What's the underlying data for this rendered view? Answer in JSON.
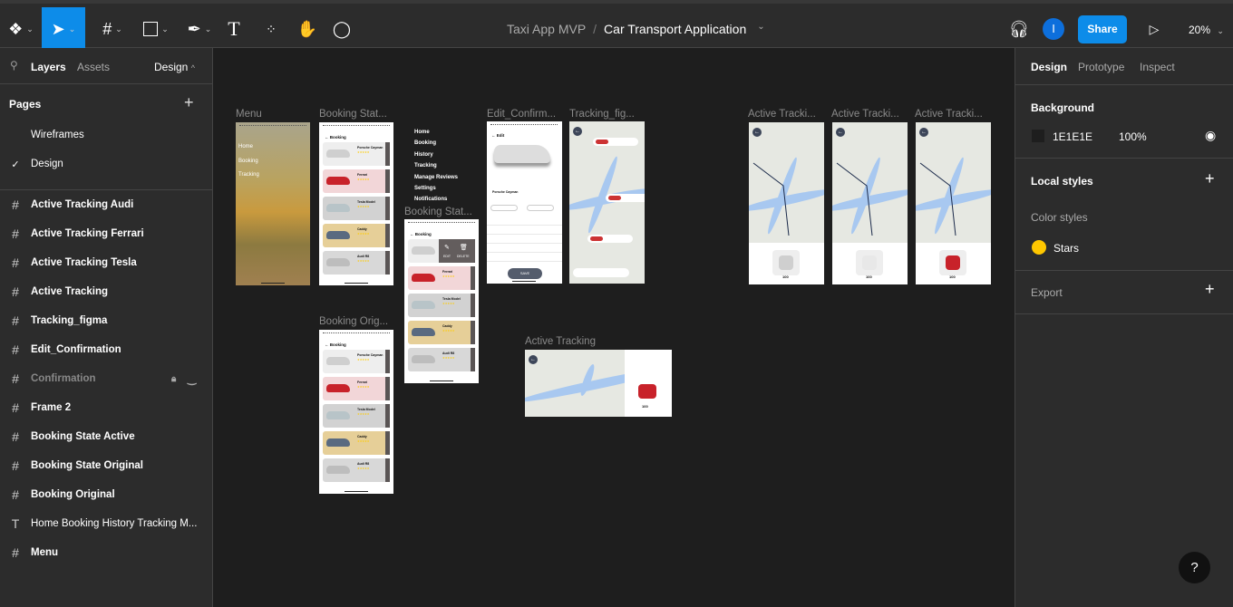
{
  "toolbar": {
    "breadcrumb_project": "Taxi App MVP",
    "breadcrumb_sep": "/",
    "file_name": "Car Transport Application",
    "avatar_initial": "I",
    "share_label": "Share",
    "zoom": "20%",
    "accent": "#0d8ce9"
  },
  "left_panel": {
    "tabs": [
      "Layers",
      "Assets"
    ],
    "page_dropdown": "Design",
    "pages_title": "Pages",
    "pages": [
      {
        "label": "Wireframes",
        "selected": false
      },
      {
        "label": "Design",
        "selected": true
      }
    ],
    "layers": [
      {
        "label": "Active Tracking Audi",
        "type": "frame"
      },
      {
        "label": "Active Tracking Ferrari",
        "type": "frame"
      },
      {
        "label": "Active Tracking Tesla",
        "type": "frame"
      },
      {
        "label": "Active Tracking",
        "type": "frame"
      },
      {
        "label": "Tracking_figma",
        "type": "frame"
      },
      {
        "label": "Edit_Confirmation",
        "type": "frame"
      },
      {
        "label": "Confirmation",
        "type": "frame",
        "hidden": true,
        "locked": true
      },
      {
        "label": "Frame 2",
        "type": "frame"
      },
      {
        "label": "Booking State Active",
        "type": "frame"
      },
      {
        "label": "Booking State Original",
        "type": "frame"
      },
      {
        "label": "Booking Original",
        "type": "frame"
      },
      {
        "label": "Home Booking History Tracking M...",
        "type": "text"
      },
      {
        "label": "Menu",
        "type": "frame"
      }
    ]
  },
  "right_panel": {
    "tabs": [
      "Design",
      "Prototype",
      "Inspect"
    ],
    "background_title": "Background",
    "bg_hex": "1E1E1E",
    "bg_opacity": "100%",
    "local_styles": "Local styles",
    "color_styles": "Color styles",
    "style_name": "Stars",
    "style_color": "#FFC700",
    "export": "Export"
  },
  "canvas": {
    "frame_labels": {
      "menu": "Menu",
      "booking_state1": "Booking Stat...",
      "booking_state2": "Booking Stat...",
      "edit": "Edit_Confirm...",
      "tracking": "Tracking_fig...",
      "at1": "Active Tracki...",
      "at2": "Active Tracki...",
      "at3": "Active Tracki...",
      "booking_orig": "Booking Orig...",
      "active_tracking": "Active Tracking"
    },
    "menu_items": [
      "Home",
      "Booking",
      "Tracking"
    ],
    "nav_text": [
      "Home",
      "Booking",
      "History",
      "Tracking",
      "Manage Reviews",
      "Settings",
      "Notifications"
    ],
    "booking_title": "Booking",
    "cars": [
      {
        "name": "Porsche Cayman",
        "bg": "#eeeeee",
        "car": "#cfcfcf"
      },
      {
        "name": "Ferrari",
        "bg": "#f2d6d8",
        "car": "#c8222a"
      },
      {
        "name": "Tesla Model",
        "bg": "#d2d2d2",
        "car": "#b8c4c8"
      },
      {
        "name": "Caddy",
        "bg": "#e6cf98",
        "car": "#5a6a80"
      },
      {
        "name": "Audi R8",
        "bg": "#d8d8d8",
        "car": "#bdbdbd"
      }
    ],
    "edit_title": "Edit",
    "edit_btn": "EDIT",
    "delete_btn": "DELETE",
    "save": "SAVE",
    "edit_car": "Porsche Cayman",
    "speed": "100"
  },
  "help": "?"
}
